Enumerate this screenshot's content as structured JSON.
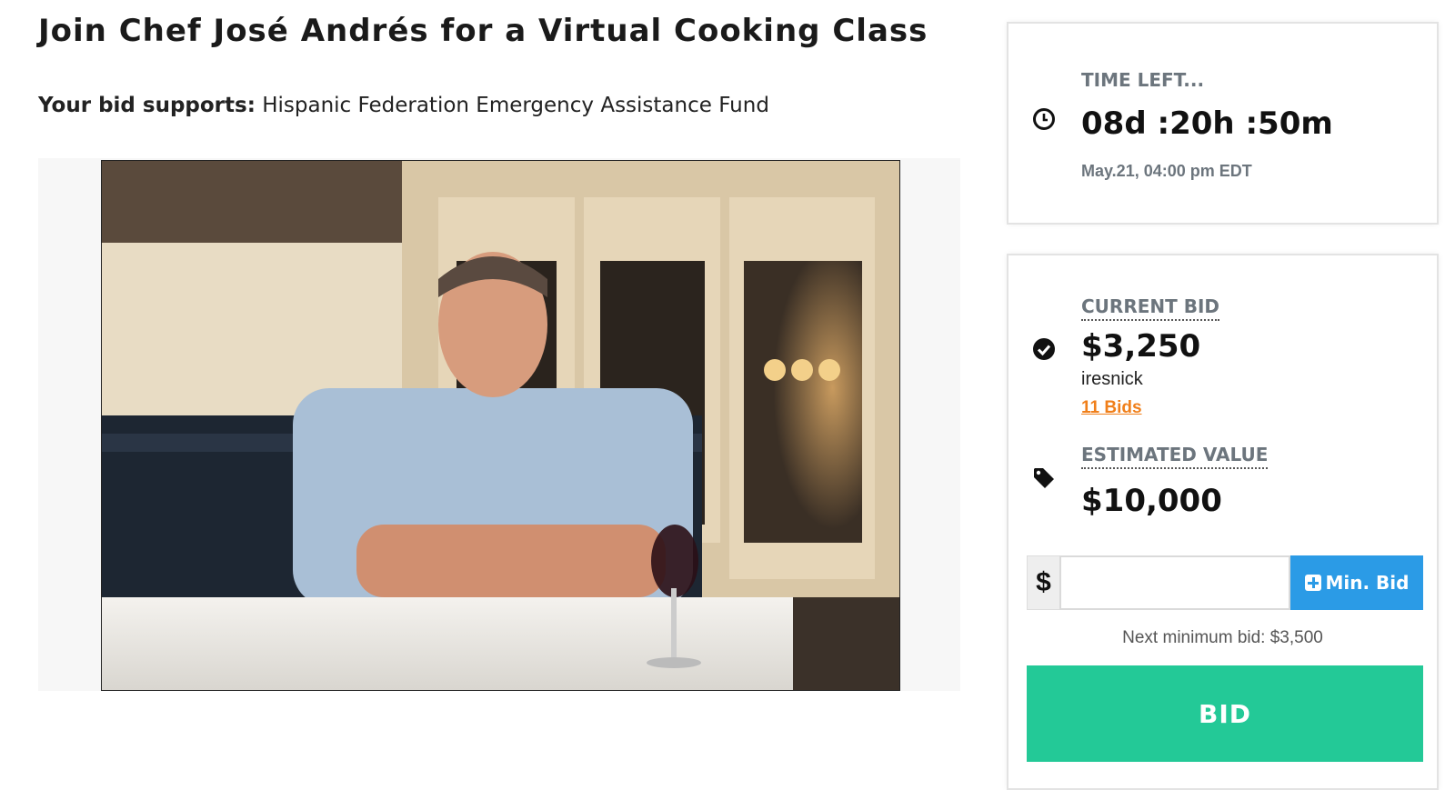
{
  "page": {
    "title": "Join Chef José Andrés for a Virtual Cooking Class",
    "supports_label": "Your bid supports:",
    "supports_value": "Hispanic Federation Emergency Assistance Fund"
  },
  "time_card": {
    "label": "TIME LEFT...",
    "countdown": "08d :20h :50m",
    "end_date": "May.21, 04:00 pm EDT",
    "icon": "clock-icon"
  },
  "bid_card": {
    "current_bid_label": "CURRENT BID",
    "current_bid": "$3,250",
    "bidder": "iresnick",
    "bids_link": "11 Bids",
    "estimated_label": "ESTIMATED VALUE",
    "estimated_value": "$10,000",
    "currency_symbol": "$",
    "bid_input_value": "",
    "min_bid_button": "Min. Bid",
    "next_min_text": "Next minimum bid:  $3,500",
    "bid_button": "BID",
    "icons": [
      "check-circle-icon",
      "tag-icon",
      "plus-square-icon"
    ]
  },
  "colors": {
    "accent_blue": "#2b9be6",
    "bid_green": "#23c997",
    "link_orange": "#f07f1a",
    "label_gray": "#6c757d"
  }
}
